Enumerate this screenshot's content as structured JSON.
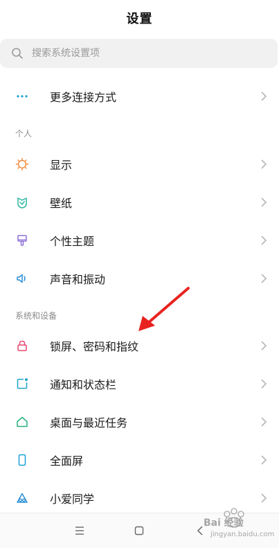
{
  "header": {
    "title": "设置"
  },
  "search": {
    "placeholder": "搜索系统设置项",
    "value": ""
  },
  "top_items": [
    {
      "label": "更多连接方式",
      "icon": "more-dots-icon",
      "color": "#1a9fd8"
    }
  ],
  "sections": [
    {
      "header": "个人",
      "items": [
        {
          "label": "显示",
          "icon": "sun-icon",
          "color": "#f08a3c"
        },
        {
          "label": "壁纸",
          "icon": "wallpaper-icon",
          "color": "#2bb5a0"
        },
        {
          "label": "个性主题",
          "icon": "theme-brush-icon",
          "color": "#8e6fd6"
        },
        {
          "label": "声音和振动",
          "icon": "speaker-icon",
          "color": "#2b8fd8"
        }
      ]
    },
    {
      "header": "系统和设备",
      "items": [
        {
          "label": "锁屏、密码和指纹",
          "icon": "lock-icon",
          "color": "#e8456b"
        },
        {
          "label": "通知和状态栏",
          "icon": "notification-icon",
          "color": "#1aa5c8"
        },
        {
          "label": "桌面与最近任务",
          "icon": "home-icon",
          "color": "#23b07a"
        },
        {
          "label": "全面屏",
          "icon": "fullscreen-phone-icon",
          "color": "#1a9fd8"
        },
        {
          "label": "小爱同学",
          "icon": "xiaoai-icon",
          "color": "#2b8fd8"
        }
      ]
    }
  ],
  "bottom_nav": [
    "menu-icon",
    "home-square-icon",
    "back-icon"
  ],
  "watermark": {
    "text_top": "Bai 经验",
    "text_bottom": "jingyan.baidu.com"
  },
  "annotation": {
    "arrow_color": "#e8231f"
  }
}
